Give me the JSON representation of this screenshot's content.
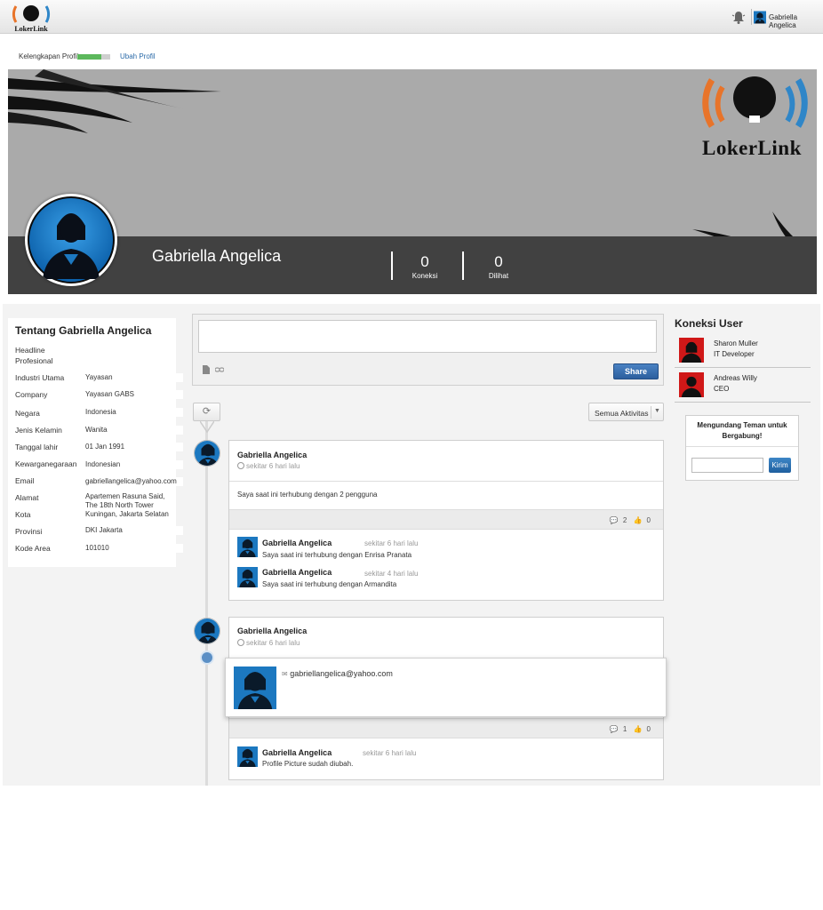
{
  "topbar": {
    "logo_text": "LokerLink",
    "user_name": "Gabriella Angelica"
  },
  "profile_completeness": {
    "label": "Kelengkapan Profil",
    "progress": 0.72,
    "edit_link": "Ubah Profil"
  },
  "banner": {
    "logo_text": "LokerLink",
    "name": "Gabriella Angelica",
    "stats": [
      {
        "value": "0",
        "label": "Koneksi"
      },
      {
        "value": "0",
        "label": "Dilihat"
      }
    ]
  },
  "about": {
    "title": "Tentang Gabriella Angelica",
    "fields": [
      {
        "label": "Headline Profesional",
        "value": ""
      },
      {
        "label": "Industri Utama",
        "value": "Yayasan"
      },
      {
        "label": "Company",
        "value": "Yayasan GABS"
      },
      {
        "label": "Negara",
        "value": "Indonesia"
      },
      {
        "label": "Jenis Kelamin",
        "value": "Wanita"
      },
      {
        "label": "Tanggal lahir",
        "value": "01 Jan 1991"
      },
      {
        "label": "Kewarganegaraan",
        "value": "Indonesian"
      },
      {
        "label": "Email",
        "value": "gabriellangelica@yahoo.com"
      },
      {
        "label": "Alamat",
        "value": "Apartemen Rasuna Said, The 18th North Tower Kuningan, Jakarta Selatan"
      },
      {
        "label": "Kota",
        "value": ""
      },
      {
        "label": "Provinsi",
        "value": "DKI Jakarta"
      },
      {
        "label": "Kode Area",
        "value": "101010"
      }
    ]
  },
  "composer": {
    "share_label": "Share"
  },
  "filter": {
    "selected": "Semua Aktivitas"
  },
  "feed": [
    {
      "author": "Gabriella Angelica",
      "time": "sekitar 6 hari lalu",
      "text": "Saya saat ini terhubung dengan 2 pengguna",
      "comments_count": "2",
      "likes_count": "0",
      "comments": [
        {
          "author": "Gabriella Angelica",
          "time": "sekitar 6 hari lalu",
          "text": "Saya saat ini terhubung dengan Enrisa Pranata"
        },
        {
          "author": "Gabriella Angelica",
          "time": "sekitar 4 hari lalu",
          "text": "Saya saat ini terhubung dengan Armandita"
        }
      ]
    },
    {
      "author": "Gabriella Angelica",
      "time": "sekitar 6 hari lalu",
      "popup_email": "gabriellangelica@yahoo.com",
      "comments_count": "1",
      "likes_count": "0",
      "comments": [
        {
          "author": "Gabriella Angelica",
          "time": "sekitar 6 hari lalu",
          "text": "Profile Picture sudah diubah."
        }
      ]
    }
  ],
  "connections": {
    "title": "Koneksi User",
    "items": [
      {
        "name": "Sharon Muller",
        "role": "IT Developer"
      },
      {
        "name": "Andreas Willy",
        "role": "CEO"
      }
    ]
  },
  "invite": {
    "title": "Mengundang Teman untuk Bergabung!",
    "send_label": "Kirim"
  },
  "colors": {
    "accent_blue": "#2c5f9e",
    "logo_orange": "#e8742a",
    "logo_blue": "#2f86c8",
    "avatar_blue": "#1c78c0",
    "avatar_red": "#d01818",
    "progress_green": "#5cb85c"
  }
}
